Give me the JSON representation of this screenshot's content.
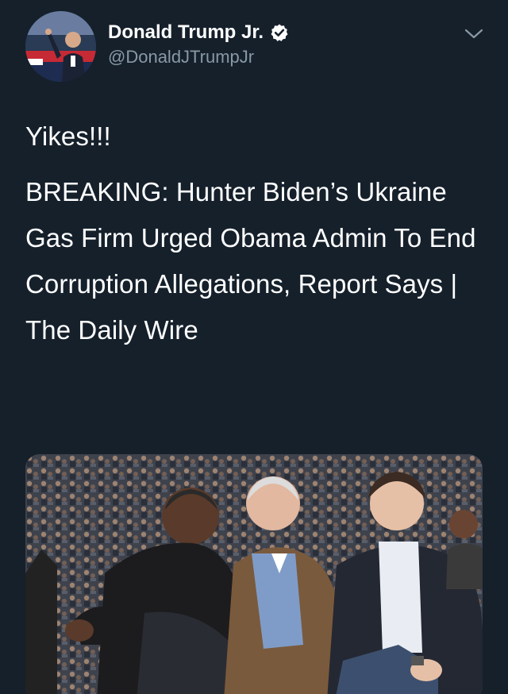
{
  "author": {
    "display_name": "Donald Trump Jr.",
    "handle": "@DonaldJTrumpJr",
    "verified": true,
    "avatar_icon": "profile-photo"
  },
  "tweet": {
    "text_line1": "Yikes!!!",
    "text_body": "BREAKING: Hunter Biden’s Ukraine Gas Firm Urged Obama Admin To End Corruption Allegations, Report Says | The Daily Wire"
  },
  "media": {
    "type": "photo"
  },
  "colors": {
    "background": "#15202b",
    "primary_text": "#ffffff",
    "secondary_text": "#8899a6",
    "verified_badge": "#ffffff"
  },
  "icons": {
    "verified": "verified-badge-icon",
    "menu": "chevron-down-icon"
  }
}
